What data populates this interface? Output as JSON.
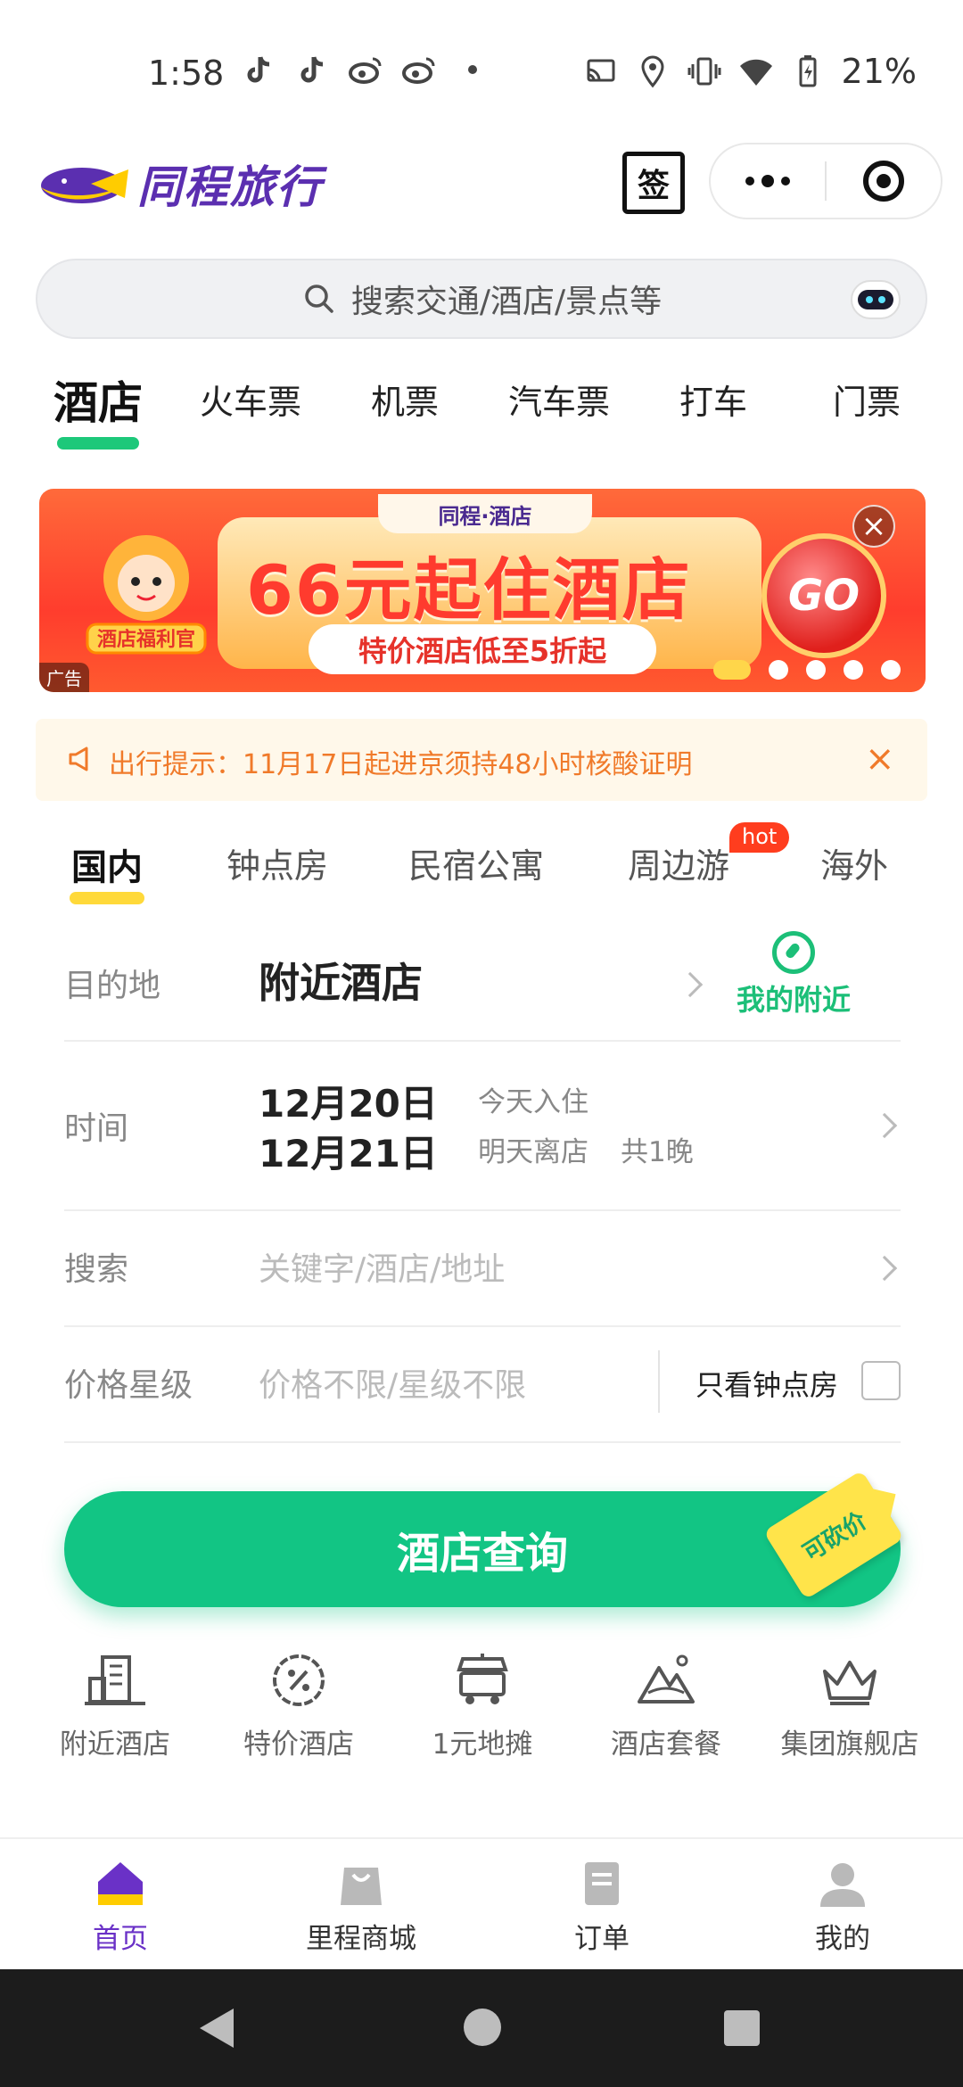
{
  "status_bar": {
    "time": "1:58",
    "battery_percent": "21%",
    "notification_icons": [
      "tiktok-icon",
      "tiktok-icon",
      "weibo-icon",
      "weibo-icon",
      "dot-icon"
    ],
    "system_icons": [
      "cast-icon",
      "location-icon",
      "vibrate-icon",
      "wifi-icon",
      "battery-icon"
    ]
  },
  "header": {
    "brand_name": "同程旅行",
    "signin_label": "签"
  },
  "search": {
    "placeholder": "搜索交通/酒店/景点等"
  },
  "main_tabs": [
    {
      "label": "酒店",
      "active": true
    },
    {
      "label": "火车票"
    },
    {
      "label": "机票"
    },
    {
      "label": "汽车票"
    },
    {
      "label": "打车"
    },
    {
      "label": "门票"
    }
  ],
  "banner": {
    "brand": "同程·酒店",
    "title": "66元起住酒店",
    "subtitle": "特价酒店低至5折起",
    "go_label": "GO",
    "ad_tag": "广告",
    "mascot_badge": "酒店福利官",
    "slide_index": 1,
    "slide_count": 5
  },
  "notice": {
    "text": "出行提示：11月17日起进京须持48小时核酸证明"
  },
  "sub_tabs": [
    {
      "label": "国内",
      "active": true
    },
    {
      "label": "钟点房"
    },
    {
      "label": "民宿公寓"
    },
    {
      "label": "周边游",
      "badge": "hot"
    },
    {
      "label": "海外"
    }
  ],
  "form": {
    "destination": {
      "label": "目的地",
      "value": "附近酒店",
      "nearby_label": "我的附近"
    },
    "time": {
      "label": "时间",
      "checkin_date": "12月20日",
      "checkin_note": "今天入住",
      "checkout_date": "12月21日",
      "checkout_note": "明天离店",
      "nights": "共1晚"
    },
    "keyword": {
      "label": "搜索",
      "placeholder": "关键字/酒店/地址"
    },
    "price": {
      "label": "价格星级",
      "placeholder": "价格不限/星级不限",
      "hourly_only_label": "只看钟点房",
      "hourly_only_checked": false
    }
  },
  "search_button": {
    "label": "酒店查询",
    "tag": "可砍价"
  },
  "quick_entries": [
    {
      "label": "附近酒店",
      "icon": "hotel-building-icon"
    },
    {
      "label": "特价酒店",
      "icon": "discount-badge-icon"
    },
    {
      "label": "1元地摊",
      "icon": "stall-cart-icon"
    },
    {
      "label": "酒店套餐",
      "icon": "mountain-package-icon"
    },
    {
      "label": "集团旗舰店",
      "icon": "crown-icon"
    }
  ],
  "bottom_nav": [
    {
      "label": "首页",
      "active": true,
      "icon": "home-icon"
    },
    {
      "label": "里程商城",
      "icon": "shopping-bag-icon"
    },
    {
      "label": "订单",
      "icon": "order-icon"
    },
    {
      "label": "我的",
      "icon": "user-icon"
    }
  ],
  "colors": {
    "brand_purple": "#5b2fb0",
    "primary_green": "#12c584",
    "notice_orange": "#f07a2a",
    "sub_tab_underline": "#ffd93a",
    "hot_red": "#ff3d1e"
  }
}
